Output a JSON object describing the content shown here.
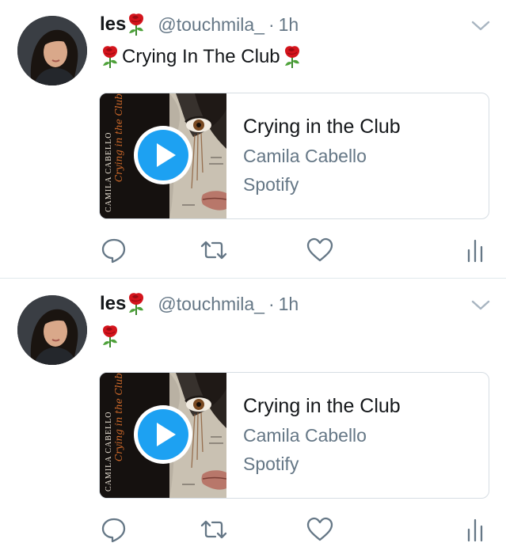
{
  "colors": {
    "primary_text": "#14171a",
    "secondary_text": "#657786",
    "divider": "#e1e8ed",
    "card_border": "#d6dde3",
    "play_button": "#1da1f2",
    "rose": "#d4141c"
  },
  "tweets": [
    {
      "display_name": "les",
      "name_emoji": "rose-emoji",
      "handle": "@touchmila_",
      "separator": "·",
      "time": "1h",
      "text": "Crying In The Club",
      "text_prefix_emoji": "rose-emoji",
      "text_suffix_emoji": "rose-emoji",
      "card": {
        "title": "Crying in the Club",
        "artist": "Camila Cabello",
        "source": "Spotify",
        "album_art_text": "CAMILA CABELLO",
        "album_art_script": "Crying in the Club"
      },
      "actions": [
        "reply-icon",
        "retweet-icon",
        "like-icon",
        "analytics-icon"
      ]
    },
    {
      "display_name": "les",
      "name_emoji": "rose-emoji",
      "handle": "@touchmila_",
      "separator": "·",
      "time": "1h",
      "text": "",
      "text_prefix_emoji": "rose-emoji",
      "card": {
        "title": "Crying in the Club",
        "artist": "Camila Cabello",
        "source": "Spotify",
        "album_art_text": "CAMILA CABELLO",
        "album_art_script": "Crying in the Club"
      },
      "actions": [
        "reply-icon",
        "retweet-icon",
        "like-icon",
        "analytics-icon"
      ]
    }
  ]
}
